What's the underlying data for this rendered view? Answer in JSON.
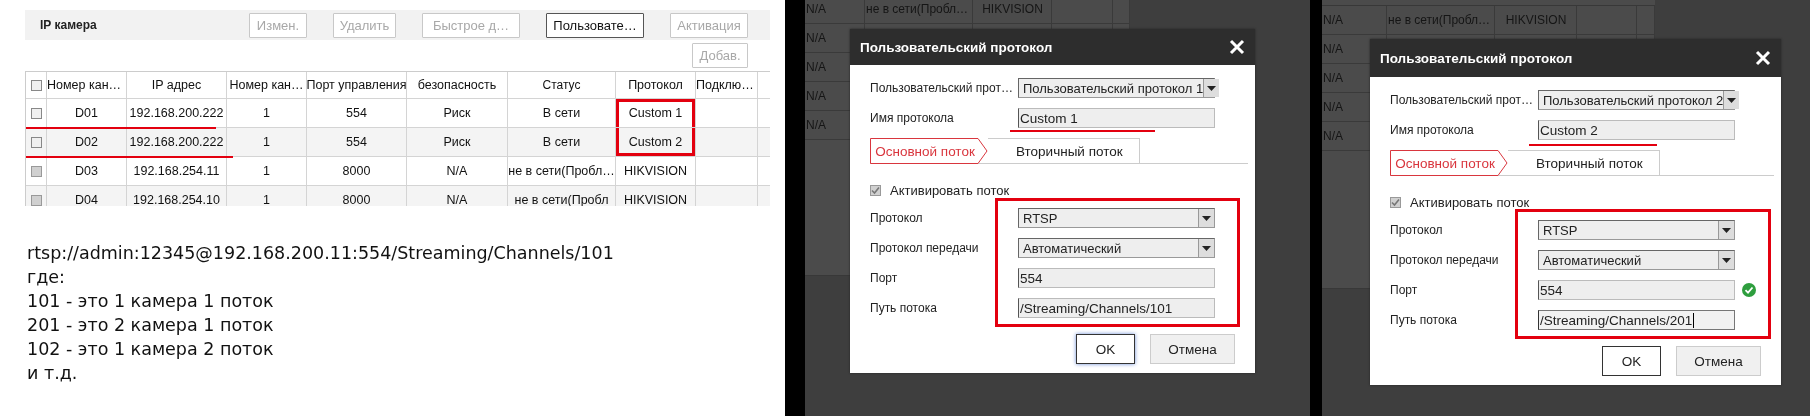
{
  "ip_camera_panel": {
    "title": "IP камера",
    "toolbar_buttons": [
      {
        "label": "Измен.",
        "disabled": true
      },
      {
        "label": "Удалить",
        "disabled": true
      },
      {
        "label": "Быстрое д…",
        "disabled": true
      },
      {
        "label": "Пользовате…",
        "disabled": false
      },
      {
        "label": "Активация",
        "disabled": true
      }
    ],
    "add_button": {
      "label": "Добав.",
      "disabled": true
    },
    "table": {
      "select_all_checked": false,
      "columns": [
        "Номер кан…",
        "IP адрес",
        "Номер кан…",
        "Порт управления",
        "безопасность",
        "Статус",
        "Протокол",
        "Подклю…"
      ],
      "rows": [
        {
          "checked": false,
          "disabled": false,
          "underlined": true,
          "protocol_boxed": true,
          "cells": [
            "D01",
            "192.168.200.222",
            "1",
            "554",
            "Риск",
            "В сети",
            "Custom 1"
          ]
        },
        {
          "checked": false,
          "disabled": false,
          "underlined": true,
          "protocol_boxed": true,
          "cells": [
            "D02",
            "192.168.200.222",
            "1",
            "554",
            "Риск",
            "В сети",
            "Custom 2"
          ]
        },
        {
          "checked": false,
          "disabled": true,
          "underlined": false,
          "protocol_boxed": false,
          "cells": [
            "D03",
            "192.168.254.11",
            "1",
            "8000",
            "N/A",
            "не в сети(Пробл…",
            "HIKVISION"
          ]
        },
        {
          "checked": false,
          "disabled": true,
          "underlined": false,
          "protocol_boxed": false,
          "cells": [
            "D04",
            "192.168.254.10",
            "1",
            "8000",
            "N/A",
            "не в сети(Пробл",
            "HIKVISION"
          ]
        }
      ]
    },
    "note_lines": [
      "rtsp://admin:12345@192.168.200.11:554/Streaming/Channels/101",
      "где:",
      "101 - это 1 камера 1 поток",
      "201 - это 2 камера 1 поток",
      "102 - это 1 камера 2 поток",
      "и т.д."
    ]
  },
  "dialog_shots": [
    {
      "background_rows": [
        {
          "cells": [
            "N/A",
            "не в сети(Пробл…",
            "HIKVISION"
          ]
        },
        {
          "cells": [
            "N/A"
          ]
        },
        {
          "cells": [
            "N/A"
          ]
        },
        {
          "cells": [
            "N/A"
          ]
        },
        {
          "cells": [
            "N/A"
          ]
        }
      ],
      "dialog": {
        "title": "Пользовательский протокол",
        "protocol_label": "Пользовательский прот…",
        "protocol_value": "Пользовательский протокол 1",
        "name_label": "Имя протокола",
        "name_value": "Custom 1",
        "name_underlined": true,
        "tabs": [
          {
            "label": "Основной поток",
            "selected": true
          },
          {
            "label": "Вторичный поток",
            "selected": false
          }
        ],
        "enable_stream": {
          "label": "Активировать поток",
          "checked": true,
          "disabled": true
        },
        "fields_boxed": true,
        "fields": [
          {
            "kind": "select",
            "label": "Протокол",
            "value": "RTSP"
          },
          {
            "kind": "select",
            "label": "Протокол передачи",
            "value": "Автоматический"
          },
          {
            "kind": "input",
            "label": "Порт",
            "value": "554",
            "valid": false,
            "focused": false
          },
          {
            "kind": "input",
            "label": "Путь потока",
            "value": "/Streaming/Channels/101",
            "valid": false,
            "focused": false
          }
        ],
        "buttons": [
          {
            "label": "OK",
            "focused": true
          },
          {
            "label": "Отмена",
            "focused": false
          }
        ]
      }
    },
    {
      "background_rows": [
        {
          "cells": [
            "N/A",
            "не в сети(Пробл…",
            "HIKVISION"
          ]
        },
        {
          "cells": [
            "N/A"
          ]
        },
        {
          "cells": [
            "N/A"
          ]
        },
        {
          "cells": [
            "N/A"
          ]
        },
        {
          "cells": [
            "N/A"
          ]
        }
      ],
      "dialog": {
        "title": "Пользовательский протокол",
        "protocol_label": "Пользовательский прот…",
        "protocol_value": "Пользовательский протокол 2",
        "name_label": "Имя протокола",
        "name_value": "Custom 2",
        "name_underlined": true,
        "tabs": [
          {
            "label": "Основной поток",
            "selected": true
          },
          {
            "label": "Вторичный поток",
            "selected": false
          }
        ],
        "enable_stream": {
          "label": "Активировать поток",
          "checked": true,
          "disabled": true
        },
        "fields_boxed": true,
        "fields": [
          {
            "kind": "select",
            "label": "Протокол",
            "value": "RTSP"
          },
          {
            "kind": "select",
            "label": "Протокол передачи",
            "value": "Автоматический"
          },
          {
            "kind": "input",
            "label": "Порт",
            "value": "554",
            "valid": true,
            "focused": false
          },
          {
            "kind": "input",
            "label": "Путь потока",
            "value": "/Streaming/Channels/201",
            "valid": false,
            "focused": true
          }
        ],
        "buttons": [
          {
            "label": "OK",
            "focused": false
          },
          {
            "label": "Отмена",
            "focused": false
          }
        ]
      }
    }
  ]
}
